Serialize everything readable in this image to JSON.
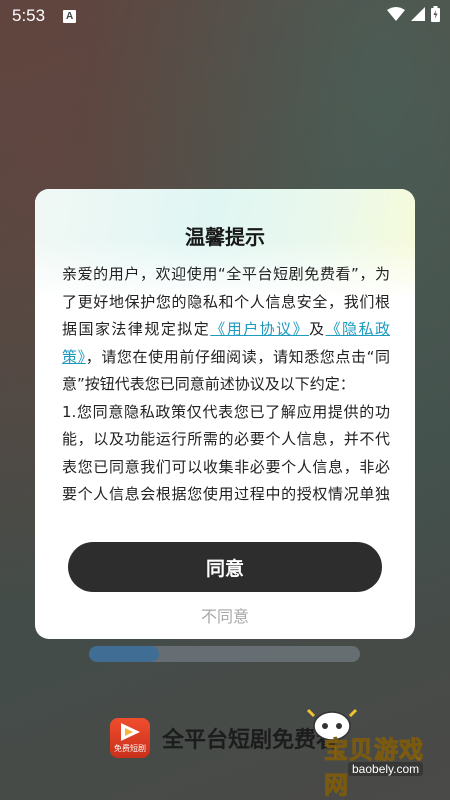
{
  "status_bar": {
    "time": "5:53",
    "notification_letter": "A",
    "icons": [
      "wifi-icon",
      "signal-icon",
      "battery-icon"
    ]
  },
  "dialog": {
    "title": "温馨提示",
    "para1": {
      "text_before": "亲爱的用户，欢迎使用“全平台短剧免费看”，为了更好地保护您的隐私和个人信息安全，我们根据国家法律规定拟定",
      "link_user_agreement": "《用户协议》",
      "and": "及",
      "link_privacy_policy": "《隐私政策》",
      "text_after": "，请您在使用前仔细阅读，请知悉您点击“同意”按钮代表您已同意前述协议及以下约定："
    },
    "para2": "1.您同意隐私政策仅代表您已了解应用提供的功能，以及功能运行所需的必要个人信息，并不代表您已同意我们可以收集非必要个人信息，非必要个人信息会根据您使用过程中的授权情况单独征求您的同意。",
    "agree_label": "同意",
    "decline_label": "不同意"
  },
  "background_app": {
    "loading_progress": 0.26,
    "logo_label": "免费短剧",
    "app_name": "全平台短剧免费看"
  },
  "watermark": {
    "brand_text": "宝贝游戏网",
    "url": "baobely.com"
  },
  "colors": {
    "link": "#1d9bbf",
    "agree_button": "#2d2d2d",
    "progress_fill": "#3f6d93",
    "logo_red": "#e8472a"
  }
}
